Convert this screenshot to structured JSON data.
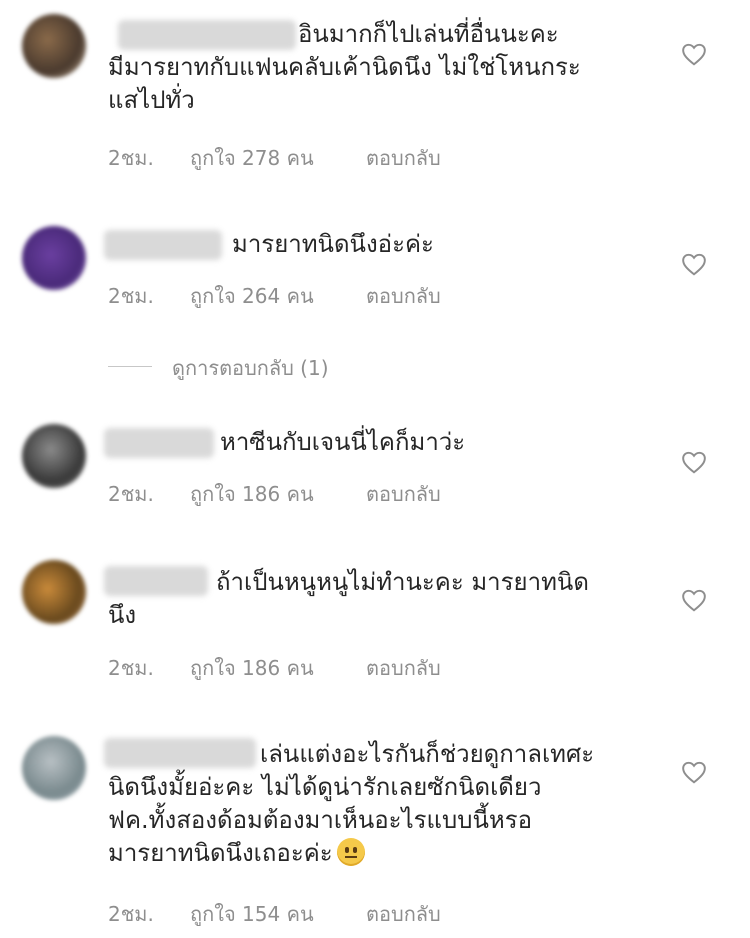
{
  "comments": [
    {
      "text": "อินมากก็ไปเล่นที่อื่นนะคะ มีมารยาทกับแฟนคลับเค้านิดนึง ไม่ใช่โหนกระแสไปทั่ว",
      "lines": [
        "อินมากก็ไปเล่นที่อื่นนะคะ",
        "มีมารยาทกับแฟนคลับเค้านิดนึง ไม่ใช่โหนกระ",
        "แสไปทั่ว"
      ],
      "time": "2ชม.",
      "likes": "ถูกใจ 278 คน",
      "reply": "ตอบกลับ"
    },
    {
      "lines": [
        "มารยาทนิดนึงอ่ะค่ะ"
      ],
      "time": "2ชม.",
      "likes": "ถูกใจ 264 คน",
      "reply": "ตอบกลับ"
    },
    {
      "lines": [
        "หาซีนกับเจนนี่ไคก็มาว่ะ"
      ],
      "time": "2ชม.",
      "likes": "ถูกใจ 186 คน",
      "reply": "ตอบกลับ"
    },
    {
      "lines": [
        "ถ้าเป็นหนูหนูไม่ทำนะคะ มารยาทนิด",
        "นึง"
      ],
      "time": "2ชม.",
      "likes": "ถูกใจ 186 คน",
      "reply": "ตอบกลับ"
    },
    {
      "lines": [
        "เล่นแต่งอะไรกันก็ช่วยดูกาลเทศะ",
        "นิดนึงมั้ยอ่ะคะ ไม่ได้ดูน่ารักเลยซักนิดเดียว",
        "ฟค.ทั้งสองด้อมต้องมาเห็นอะไรแบบนี้หรอ",
        "มารยาทนิดนึงเถอะค่ะ"
      ],
      "time": "2ชม.",
      "likes": "ถูกใจ 154 คน",
      "reply": "ตอบกลับ"
    }
  ],
  "view_replies": "ดูการตอบกลับ (1)",
  "icons": {
    "heart": "heart-outline-icon",
    "emoji": "neutral-face-emoji"
  },
  "colors": {
    "text": "#262626",
    "meta": "#8e8e8e",
    "divider": "#c7c7c7"
  }
}
